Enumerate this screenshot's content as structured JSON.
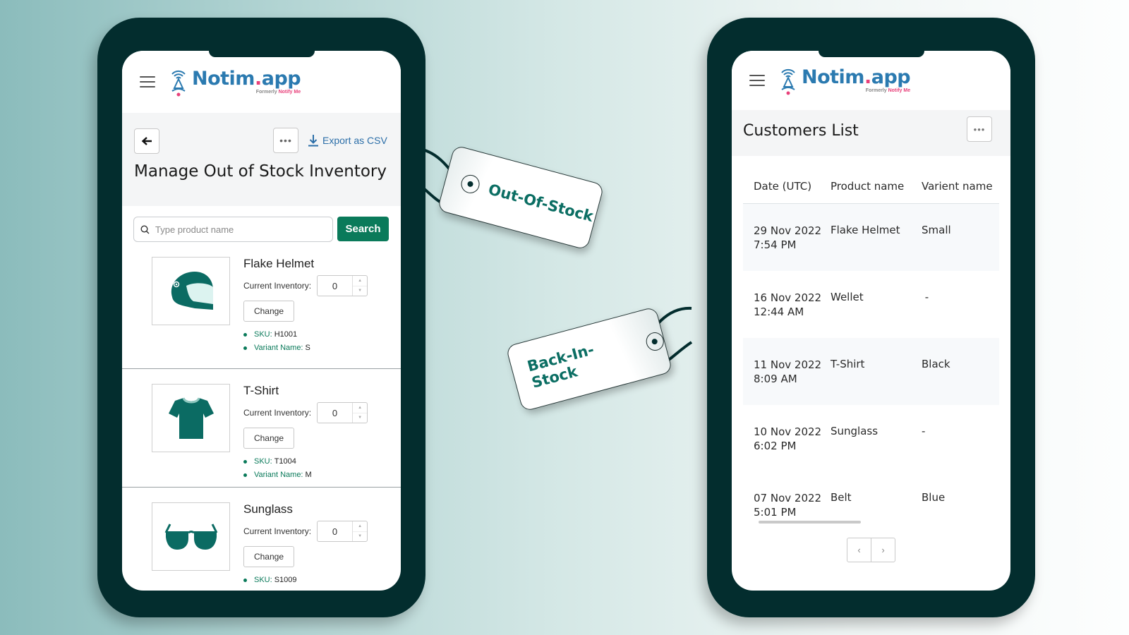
{
  "brand": {
    "name_prefix": "Notim",
    "name_dot": ".",
    "name_suffix": "app",
    "subtitle_prefix": "Formerly ",
    "subtitle_highlight": "Notify Me",
    "colors": {
      "primary": "#2b7ab0",
      "accent": "#e8407a",
      "green": "#0a7a5a",
      "phone": "#032d2e"
    }
  },
  "left_screen": {
    "header": {
      "back_icon": "arrow-left-icon",
      "more_icon": "ellipsis-icon",
      "more_label": "•••",
      "export_label": "Export as CSV",
      "title": "Manage Out of Stock Inventory"
    },
    "search": {
      "placeholder": "Type product name",
      "value": "",
      "button_label": "Search"
    },
    "products": [
      {
        "name": "Flake Helmet",
        "inventory_label": "Current Inventory:",
        "inventory_value": "0",
        "change_label": "Change",
        "sku_label": "SKU:",
        "sku": "H1001",
        "variant_label": "Variant Name:",
        "variant": "S",
        "icon": "helmet-icon"
      },
      {
        "name": "T-Shirt",
        "inventory_label": "Current Inventory:",
        "inventory_value": "0",
        "change_label": "Change",
        "sku_label": "SKU:",
        "sku": "T1004",
        "variant_label": "Variant Name:",
        "variant": "M",
        "icon": "tshirt-icon"
      },
      {
        "name": "Sunglass",
        "inventory_label": "Current Inventory:",
        "inventory_value": "0",
        "change_label": "Change",
        "sku_label": "SKU:",
        "sku": "S1009",
        "icon": "sunglasses-icon"
      }
    ]
  },
  "right_screen": {
    "title": "Customers List",
    "more_label": "•••",
    "columns": [
      "Date (UTC)",
      "Product name",
      "Varient name"
    ],
    "rows": [
      {
        "date": "29 Nov 2022",
        "time": "7:54 PM",
        "product": "Flake Helmet",
        "variant": "Small"
      },
      {
        "date": "16 Nov 2022",
        "time": "12:44 AM",
        "product": "Wellet",
        "variant": " -"
      },
      {
        "date": "11 Nov 2022",
        "time": "8:09 AM",
        "product": "T-Shirt",
        "variant": "Black"
      },
      {
        "date": "10 Nov 2022",
        "time": "6:02 PM",
        "product": "Sunglass",
        "variant": "-"
      },
      {
        "date": "07 Nov 2022",
        "time": "5:01 PM",
        "product": "Belt",
        "variant": "Blue"
      }
    ],
    "pager": {
      "prev": "‹",
      "next": "›"
    }
  },
  "tags": {
    "out_of_stock": "Out-Of-Stock",
    "back_in_stock": "Back-In-Stock"
  }
}
